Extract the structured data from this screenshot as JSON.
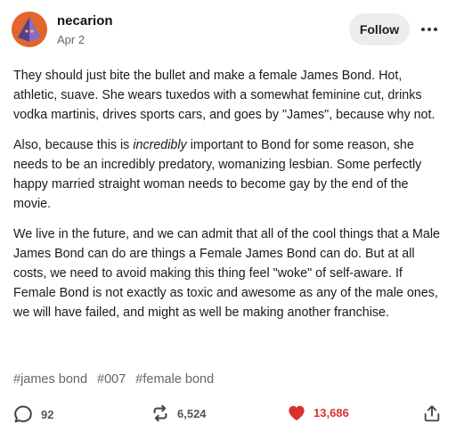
{
  "post": {
    "username": "necarion",
    "date": "Apr 2",
    "follow_label": "Follow",
    "paragraphs": {
      "p1": "They should just bite the bullet and make a female James Bond.  Hot, athletic, suave. She wears tuxedos with a somewhat feminine cut, drinks vodka martinis, drives sports cars, and goes by \"James\", because why not.",
      "p2_before": "Also, because this is ",
      "p2_em": "incredibly",
      "p2_after": " important to Bond for some reason, she needs to be an incredibly predatory, womanizing lesbian. Some perfectly happy married straight woman needs to become gay by the end of the movie.",
      "p3": "We live in the future, and we can admit that all of the cool things that a Male James Bond can do are things a Female James Bond can do. But at all costs, we need to avoid making this thing feel \"woke\" of self-aware. If Female Bond is not exactly as toxic and awesome as any of the male ones, we will have failed, and might as well be making another franchise."
    },
    "tags": [
      "#james bond",
      "#007",
      "#female bond"
    ]
  },
  "footer": {
    "replies": "92",
    "reblogs": "6,524",
    "likes": "13,686"
  },
  "colors": {
    "like_red": "#d9302e",
    "avatar_orange": "#e0662b",
    "avatar_purple": "#6b4fa0"
  },
  "icons": [
    "more-options-icon",
    "reply-icon",
    "reblog-icon",
    "heart-icon",
    "share-icon"
  ]
}
